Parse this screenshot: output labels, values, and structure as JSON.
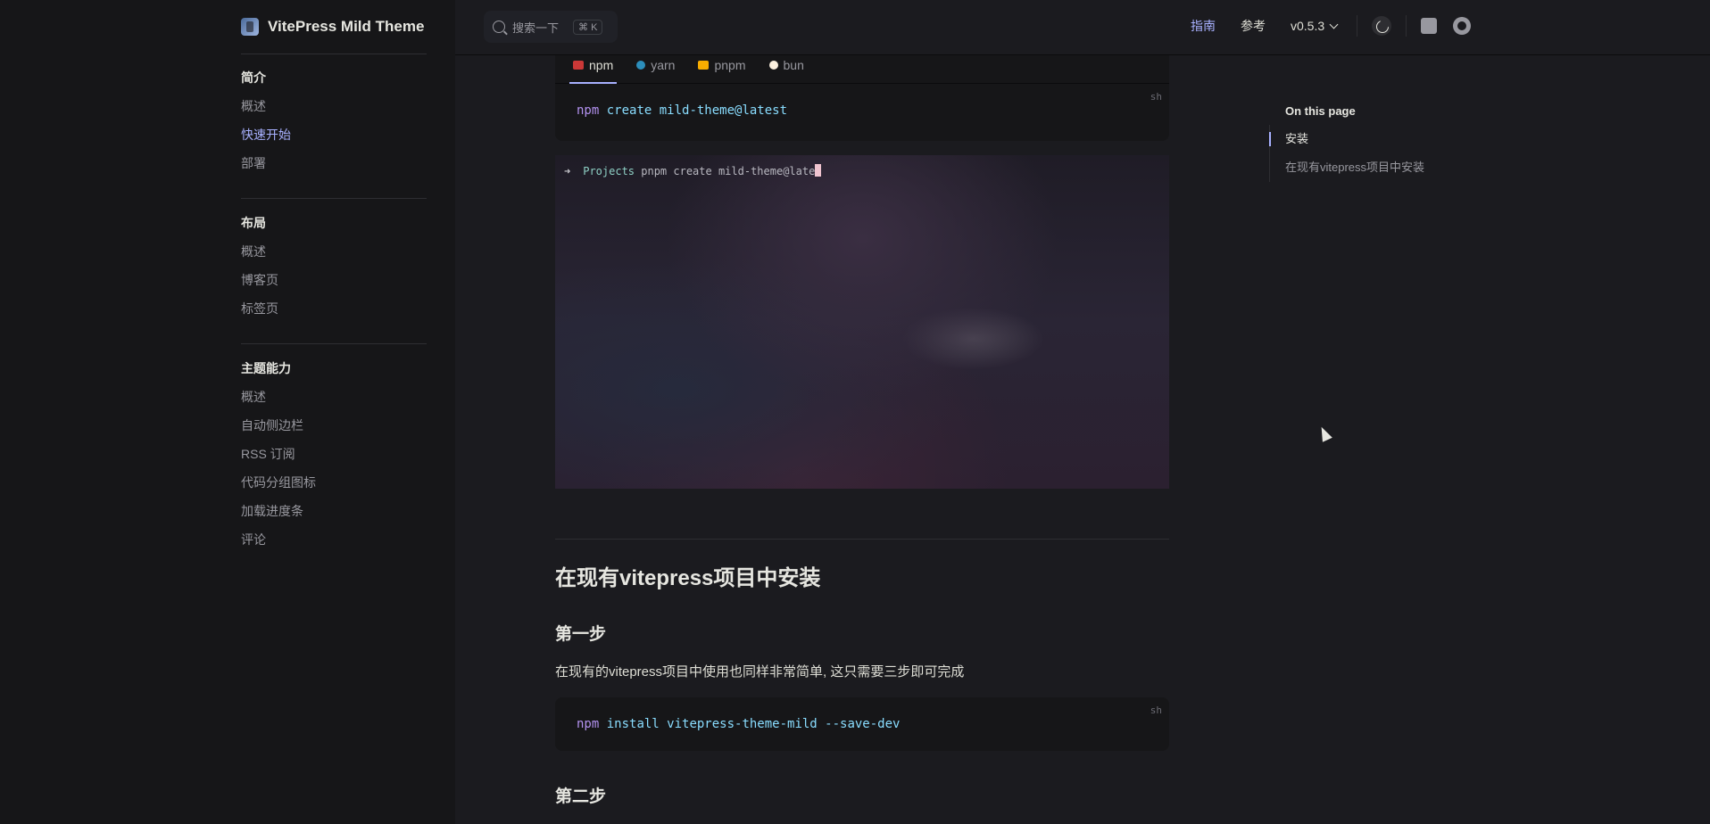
{
  "brand": {
    "title": "VitePress Mild Theme"
  },
  "sidebar": {
    "groups": [
      {
        "title": "简介",
        "items": [
          {
            "label": "概述"
          },
          {
            "label": "快速开始",
            "active": true
          },
          {
            "label": "部署"
          }
        ]
      },
      {
        "title": "布局",
        "items": [
          {
            "label": "概述"
          },
          {
            "label": "博客页"
          },
          {
            "label": "标签页"
          }
        ]
      },
      {
        "title": "主题能力",
        "items": [
          {
            "label": "概述"
          },
          {
            "label": "自动侧边栏"
          },
          {
            "label": "RSS 订阅"
          },
          {
            "label": "代码分组图标"
          },
          {
            "label": "加载进度条"
          },
          {
            "label": "评论"
          }
        ]
      }
    ]
  },
  "topbar": {
    "search_label": "搜索一下",
    "search_kbd": "⌘ K",
    "nav": [
      {
        "label": "指南",
        "active": true
      },
      {
        "label": "参考"
      }
    ],
    "version": "v0.5.3",
    "icons": [
      "moon-icon",
      "rss-icon",
      "github-icon"
    ]
  },
  "code_tabs": {
    "tabs": [
      {
        "label": "npm",
        "color": "#cb3837",
        "active": true
      },
      {
        "label": "yarn",
        "color": "#2c8ebb"
      },
      {
        "label": "pnpm",
        "color": "#f9ad00"
      },
      {
        "label": "bun",
        "color": "#fbf0df"
      }
    ],
    "lang": "sh",
    "cmd_kw": "npm",
    "cmd_rest": " create mild-theme@latest"
  },
  "terminal": {
    "arrow": "➜",
    "path": "Projects",
    "command": " pnpm create mild-theme@late"
  },
  "section": {
    "h2": "在现有vitepress项目中安装",
    "step1": "第一步",
    "para": "在现有的vitepress项目中使用也同样非常简单, 这只需要三步即可完成",
    "code2_lang": "sh",
    "code2_kw": "npm",
    "code2_rest": " install vitepress-theme-mild --save-dev",
    "step2": "第二步"
  },
  "outline": {
    "title": "On this page",
    "links": [
      {
        "label": "安装",
        "active": true
      },
      {
        "label": "在现有vitepress项目中安装"
      }
    ]
  },
  "colors": {
    "accent": "#a8b1ff",
    "background": "#1b1b1f",
    "sidebar": "#161618"
  }
}
